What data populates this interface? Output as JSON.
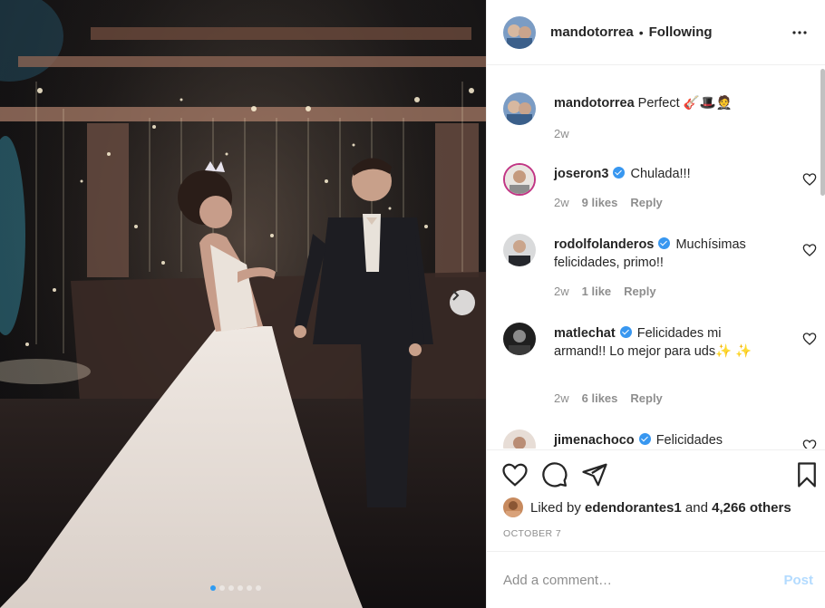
{
  "post": {
    "author": "mandotorrea",
    "follow_separator": "•",
    "follow_status": "Following",
    "carousel": {
      "dot_count": 6,
      "active_index": 0
    }
  },
  "comments": [
    {
      "username": "mandotorrea",
      "verified": false,
      "text": "Perfect 🎸🎩🤵",
      "time": "2w",
      "likes": "",
      "reply": ""
    },
    {
      "username": "joseron3",
      "verified": true,
      "text": "Chulada!!!",
      "time": "2w",
      "likes": "9 likes",
      "reply": "Reply"
    },
    {
      "username": "rodolfolanderos",
      "verified": true,
      "text": "Muchísimas felicidades, primo!!",
      "time": "2w",
      "likes": "1 like",
      "reply": "Reply"
    },
    {
      "username": "matlechat",
      "verified": true,
      "text": "Felicidades mi armand!! Lo mejor para uds✨ ✨",
      "time": "2w",
      "likes": "6 likes",
      "reply": "Reply"
    },
    {
      "username": "jimenachoco",
      "verified": true,
      "text": "Felicidades",
      "time": "",
      "likes": "",
      "reply": ""
    }
  ],
  "likes": {
    "prefix": "Liked by",
    "user": "edendorantes1",
    "and": "and",
    "others": "4,266 others"
  },
  "date": "OCTOBER 7",
  "add_comment": {
    "placeholder": "Add a comment…",
    "post_label": "Post"
  },
  "icons": [
    "heart-icon",
    "comment-icon",
    "share-icon",
    "bookmark-icon",
    "more-icon",
    "chevron-right-icon",
    "verified-icon"
  ],
  "colors": {
    "link_blue": "#3897f0",
    "post_disabled": "#b3dbff",
    "muted": "#8e8e8e",
    "border": "#efefef"
  }
}
